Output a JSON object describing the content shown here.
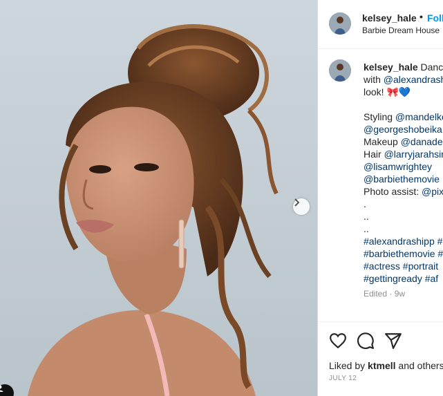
{
  "post": {
    "username": "kelsey_hale",
    "follow_label": "Follow",
    "location": "Barbie Dream House",
    "icons": {
      "next": "chevron-right-icon",
      "tag": "user-tag-icon",
      "like": "heart-icon",
      "comment": "comment-icon",
      "share": "paper-plane-icon"
    }
  },
  "caption": {
    "username": "kelsey_hale",
    "line1_text": "Dance",
    "line2_prefix": "with ",
    "line2_mention": "@alexandrashipp",
    "line3_text": "look! 🎀💙",
    "styling_label": "Styling ",
    "styling_mention": "@mandelkornjenna",
    "line_georges": "@georgeshobeika",
    "makeup_label": "Makeup ",
    "makeup_mention": "@danadelia",
    "hair_label": "Hair ",
    "hair_mention": "@larryjarahsingh",
    "line_lisam": "@lisamwrightey",
    "line_barbie": "@barbiethemovie",
    "photo_assist_label": "Photo assist: ",
    "photo_assist_mention": "@pixie",
    "dot1": ".",
    "dot2": "..",
    "dot3": "..",
    "hashtags_1": "#alexandrashipp #",
    "hashtags_2": "#barbiethemovie #",
    "hashtags_3": "#actress #portrait",
    "hashtags_4": "#gettingready #af",
    "meta": "Edited · 9w"
  },
  "footer": {
    "liked_by_prefix": "Liked by ",
    "liked_by_user": "ktmell",
    "liked_by_suffix": " and others",
    "date": "JULY 12"
  }
}
